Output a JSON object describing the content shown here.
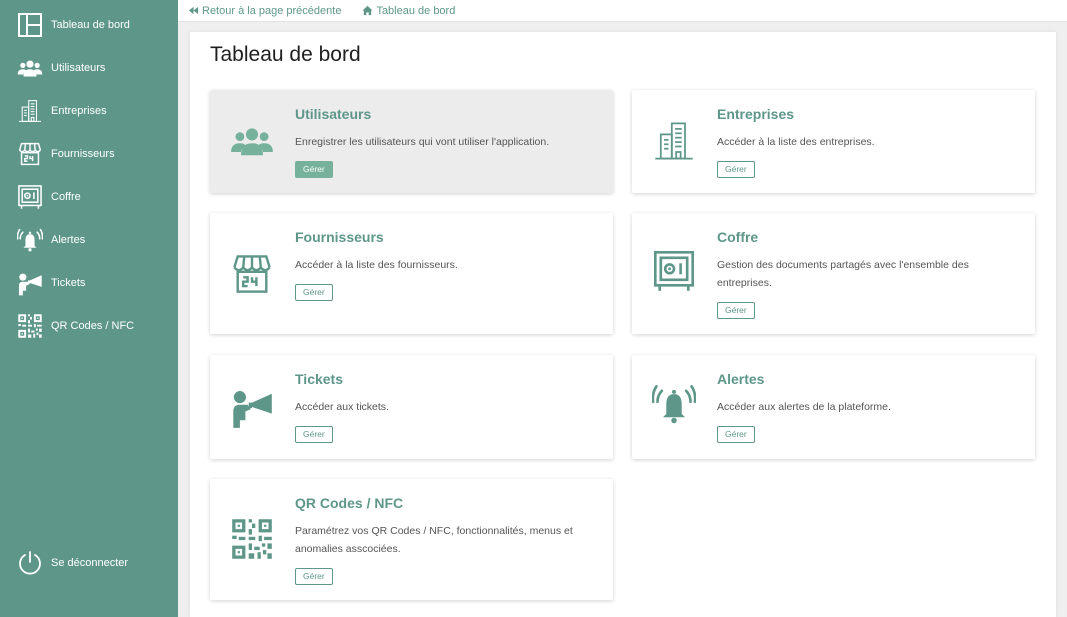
{
  "sidebar": {
    "items": [
      {
        "label": "Tableau de bord",
        "icon": "dashboard-icon"
      },
      {
        "label": "Utilisateurs",
        "icon": "users-icon"
      },
      {
        "label": "Entreprises",
        "icon": "building-icon"
      },
      {
        "label": "Fournisseurs",
        "icon": "store-icon"
      },
      {
        "label": "Coffre",
        "icon": "safe-icon"
      },
      {
        "label": "Alertes",
        "icon": "alarm-bell-icon"
      },
      {
        "label": "Tickets",
        "icon": "megaphone-person-icon"
      },
      {
        "label": "QR Codes / NFC",
        "icon": "qr-code-icon"
      }
    ],
    "logout_label": "Se déconnecter"
  },
  "breadcrumb": {
    "back_label": "Retour à la page précédente",
    "home_label": "Tableau de bord"
  },
  "page": {
    "title": "Tableau de bord"
  },
  "cards": [
    {
      "title": "Utilisateurs",
      "description": "Enregistrer les utilisateurs qui vont utiliser l'application.",
      "button": "Gérer",
      "icon": "users-icon"
    },
    {
      "title": "Entreprises",
      "description": "Accéder à la liste des entreprises.",
      "button": "Gérer",
      "icon": "building-icon"
    },
    {
      "title": "Fournisseurs",
      "description": "Accéder à la liste des fournisseurs.",
      "button": "Gérer",
      "icon": "store-icon"
    },
    {
      "title": "Coffre",
      "description": "Gestion des documents partagés avec l'ensemble des entreprises.",
      "button": "Gérer",
      "icon": "safe-icon"
    },
    {
      "title": "Tickets",
      "description": "Accéder aux tickets.",
      "button": "Gérer",
      "icon": "megaphone-person-icon"
    },
    {
      "title": "Alertes",
      "description": "Accéder aux alertes de la plateforme.",
      "button": "Gérer",
      "icon": "alarm-bell-icon"
    },
    {
      "title": "QR Codes / NFC",
      "description": "Paramétrez vos QR Codes / NFC, fonctionnalités, menus et anomalies asscociées.",
      "button": "Gérer",
      "icon": "qr-code-icon"
    }
  ],
  "colors": {
    "brand": "#5e978a",
    "button_active": "#76b19c",
    "background": "#efefef"
  }
}
